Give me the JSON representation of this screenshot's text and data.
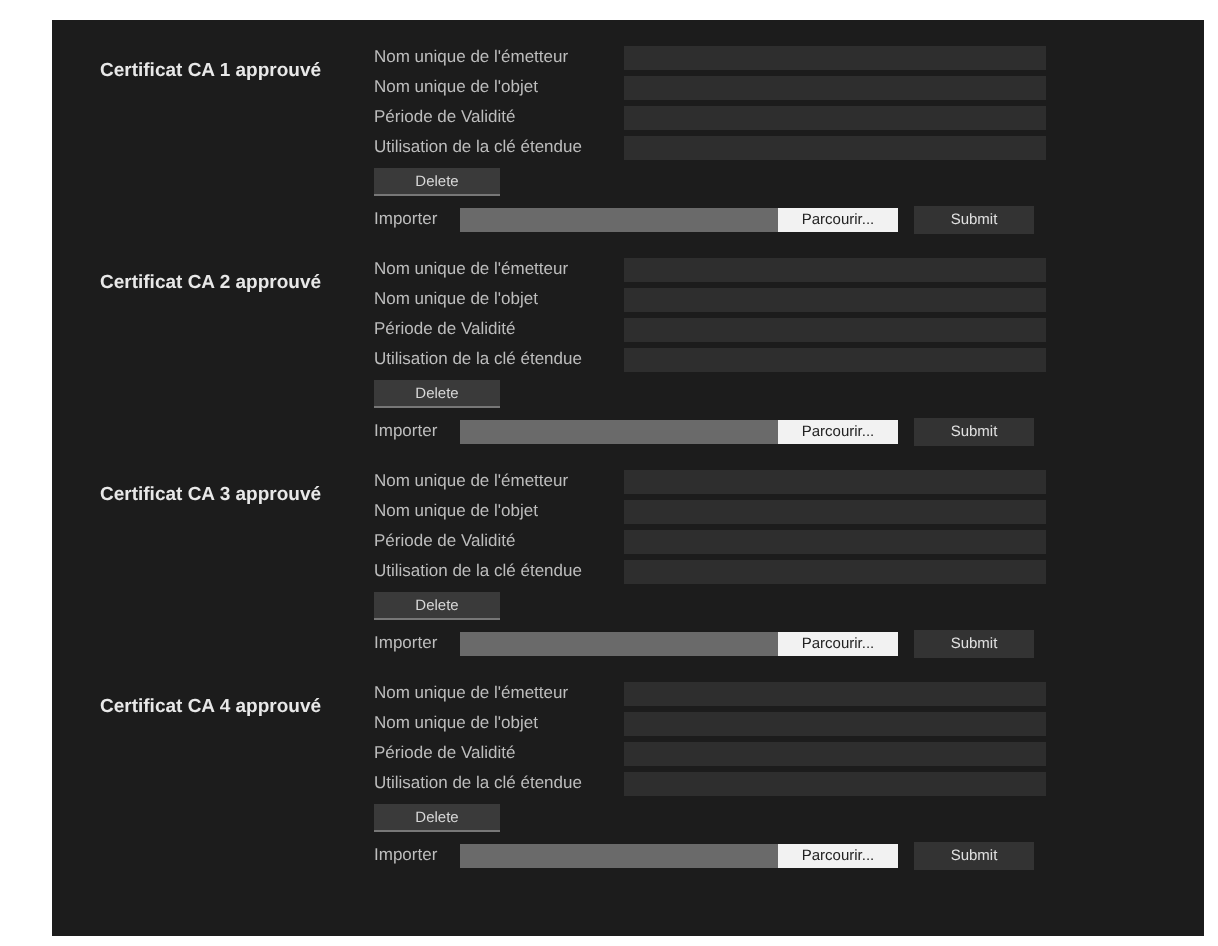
{
  "certificates": [
    {
      "title": "Certificat CA 1 approuvé",
      "fields": [
        "Nom unique de l'émetteur",
        "Nom unique de l'objet",
        "Période de Validité",
        "Utilisation de la clé étendue"
      ],
      "delete": "Delete",
      "import_label": "Importer",
      "browse": "Parcourir...",
      "submit": "Submit"
    },
    {
      "title": "Certificat CA 2 approuvé",
      "fields": [
        "Nom unique de l'émetteur",
        "Nom unique de l'objet",
        "Période de Validité",
        "Utilisation de la clé étendue"
      ],
      "delete": "Delete",
      "import_label": "Importer",
      "browse": "Parcourir...",
      "submit": "Submit"
    },
    {
      "title": "Certificat CA 3 approuvé",
      "fields": [
        "Nom unique de l'émetteur",
        "Nom unique de l'objet",
        "Période de Validité",
        "Utilisation de la clé étendue"
      ],
      "delete": "Delete",
      "import_label": "Importer",
      "browse": "Parcourir...",
      "submit": "Submit"
    },
    {
      "title": "Certificat CA 4 approuvé",
      "fields": [
        "Nom unique de l'émetteur",
        "Nom unique de l'objet",
        "Période de Validité",
        "Utilisation de la clé étendue"
      ],
      "delete": "Delete",
      "import_label": "Importer",
      "browse": "Parcourir...",
      "submit": "Submit"
    }
  ]
}
